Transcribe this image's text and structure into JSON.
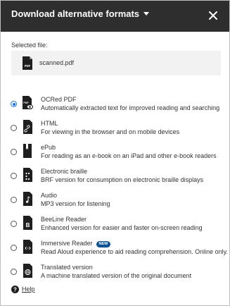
{
  "dialog": {
    "title": "Download alternative formats",
    "close_icon": "close-icon"
  },
  "selected_file": {
    "label": "Selected file:",
    "name": "scanned.pdf",
    "icon": "pdf-file-icon"
  },
  "options": [
    {
      "title": "OCRed PDF",
      "description": "Automatically extracted text for improved reading and searching",
      "checked": true,
      "icon": "ocr-pdf-icon"
    },
    {
      "title": "HTML",
      "description": "For viewing in the browser and on mobile devices",
      "checked": false,
      "icon": "html-file-icon"
    },
    {
      "title": "ePub",
      "description": "For reading as an e-book on an iPad and other e-book readers",
      "checked": false,
      "icon": "epub-book-icon"
    },
    {
      "title": "Electronic braille",
      "description": "BRF version for consumption on electronic braille displays",
      "checked": false,
      "icon": "braille-file-icon"
    },
    {
      "title": "Audio",
      "description": "MP3 version for listening",
      "checked": false,
      "icon": "audio-file-icon"
    },
    {
      "title": "BeeLine Reader",
      "description": "Enhanced version for easier and faster on-screen reading",
      "checked": false,
      "icon": "beeline-file-icon"
    },
    {
      "title": "Immersive Reader",
      "badge": "NEW",
      "description": "Read Aloud experience to aid reading comprehension. Online only.",
      "checked": false,
      "icon": "immersive-reader-icon"
    },
    {
      "title": "Translated version",
      "description": "A machine translated version of the original document",
      "checked": false,
      "icon": "globe-file-icon"
    }
  ],
  "help": {
    "label": "Help",
    "icon": "help-circle-icon"
  },
  "colors": {
    "header_bg": "#2e2e2e",
    "accent": "#1a73e8",
    "badge_bg": "#0b5394",
    "file_box_bg": "#f2f2f2"
  }
}
